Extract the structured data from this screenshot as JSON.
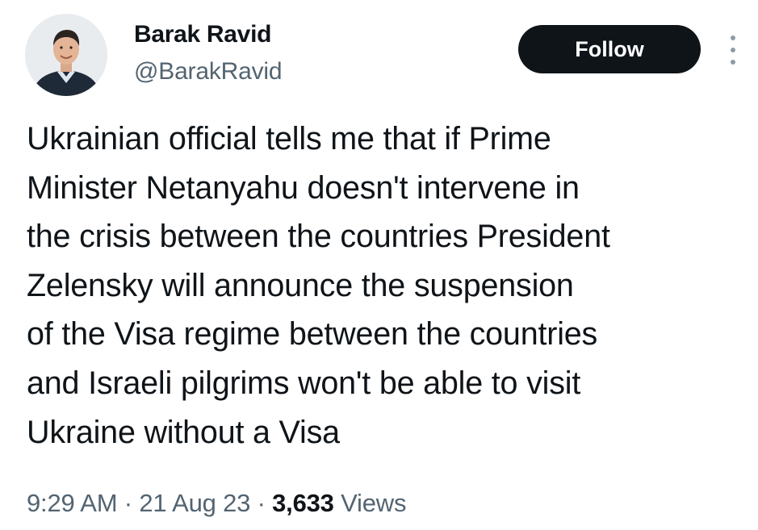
{
  "author": {
    "name": "Barak Ravid",
    "handle": "@BarakRavid",
    "avatar_icon": "profile-photo"
  },
  "actions": {
    "follow_label": "Follow",
    "more_icon": "vertical-ellipsis-icon"
  },
  "tweet": {
    "lines": [
      "Ukrainian official tells me that if Prime",
      "Minister Netanyahu doesn't intervene in",
      "the crisis between the countries President",
      "Zelensky will announce the suspension",
      "of the Visa regime between the countries",
      "and Israeli pilgrims won't be able to visit",
      "Ukraine without a Visa"
    ]
  },
  "meta": {
    "time": "9:29 AM",
    "separator": "·",
    "date": "21 Aug 23",
    "view_count": "3,633",
    "views_label": "Views"
  },
  "colors": {
    "text_primary": "#0f1419",
    "text_secondary": "#536471",
    "button_bg": "#0f1419",
    "button_text": "#ffffff"
  }
}
